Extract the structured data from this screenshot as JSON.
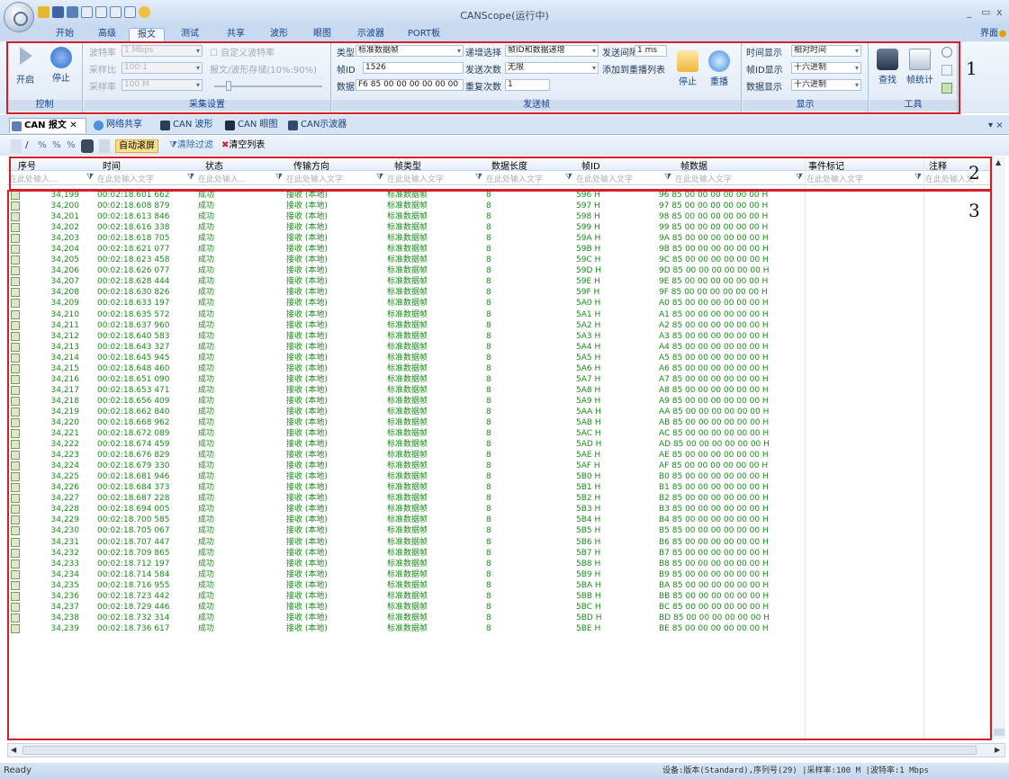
{
  "app": {
    "title": "CANScope(运行中)",
    "help": "界面"
  },
  "menu": [
    "开始",
    "高级",
    "报文",
    "测试",
    "共享",
    "波形",
    "眼图",
    "示波器",
    "PORT板"
  ],
  "ribbon": {
    "control": {
      "start": "开启",
      "stop": "停止",
      "label": "控制"
    },
    "acq": {
      "baud_label": "波特率",
      "baud_value": "1 Mbps",
      "sample_ratio_label": "采样比",
      "sample_ratio_value": "100:1",
      "sample_rate_label": "采样率",
      "sample_rate_value": "100 M",
      "custom_baud": "自定义波特率",
      "store": "报文/波形存储(10%:90%)",
      "label": "采集设置"
    },
    "send": {
      "type_label": "类型",
      "type_value": "标准数据帧",
      "id_label": "帧ID",
      "id_value": "1526",
      "data_label": "数据",
      "data_value": "F6 85 00 00 00 00 00 00",
      "inc_label": "递增选择",
      "inc_value": "帧ID和数据递增",
      "count_label": "发送次数",
      "count_value": "无限",
      "repeat_label": "重复次数",
      "repeat_value": "1",
      "interval_label": "发送间隔",
      "interval_value": "1 ms",
      "add_list": "添加到重播列表",
      "stop": "停止",
      "replay": "重播",
      "label": "发送帧"
    },
    "display": {
      "time_label": "时间显示",
      "time_value": "相对时间",
      "id_label": "帧ID显示",
      "id_value": "十六进制",
      "data_label": "数据显示",
      "data_value": "十六进制",
      "label": "显示"
    },
    "tools": {
      "find": "查找",
      "stats": "帧统计",
      "label": "工具"
    }
  },
  "doc_tabs": [
    "CAN 报文",
    "网络共享",
    "CAN 波形",
    "CAN 眼图",
    "CAN示波器"
  ],
  "toolbar2": {
    "auto_scroll": "自动滚屏",
    "clear_filter": "清除过滤",
    "clear_list": "清空列表"
  },
  "columns": [
    "序号",
    "时间",
    "状态",
    "传输方向",
    "帧类型",
    "数据长度",
    "帧ID",
    "帧数据",
    "事件标记",
    "注释"
  ],
  "filter_placeholder": "在此处输入文字",
  "filter_placeholder_short": "在此处输入...",
  "callouts": [
    "1",
    "2",
    "3"
  ],
  "rows": [
    [
      "34,199",
      "00:02:18.601 662",
      "成功",
      "接收 (本地)",
      "标准数据帧",
      "8",
      "596 H",
      "96 85 00 00 00 00 00 00 H"
    ],
    [
      "34,200",
      "00:02:18.608 879",
      "成功",
      "接收 (本地)",
      "标准数据帧",
      "8",
      "597 H",
      "97 85 00 00 00 00 00 00 H"
    ],
    [
      "34,201",
      "00:02:18.613 846",
      "成功",
      "接收 (本地)",
      "标准数据帧",
      "8",
      "598 H",
      "98 85 00 00 00 00 00 00 H"
    ],
    [
      "34,202",
      "00:02:18.616 338",
      "成功",
      "接收 (本地)",
      "标准数据帧",
      "8",
      "599 H",
      "99 85 00 00 00 00 00 00 H"
    ],
    [
      "34,203",
      "00:02:18.618 705",
      "成功",
      "接收 (本地)",
      "标准数据帧",
      "8",
      "59A H",
      "9A 85 00 00 00 00 00 00 H"
    ],
    [
      "34,204",
      "00:02:18.621 077",
      "成功",
      "接收 (本地)",
      "标准数据帧",
      "8",
      "59B H",
      "9B 85 00 00 00 00 00 00 H"
    ],
    [
      "34,205",
      "00:02:18.623 458",
      "成功",
      "接收 (本地)",
      "标准数据帧",
      "8",
      "59C H",
      "9C 85 00 00 00 00 00 00 H"
    ],
    [
      "34,206",
      "00:02:18.626 077",
      "成功",
      "接收 (本地)",
      "标准数据帧",
      "8",
      "59D H",
      "9D 85 00 00 00 00 00 00 H"
    ],
    [
      "34,207",
      "00:02:18.628 444",
      "成功",
      "接收 (本地)",
      "标准数据帧",
      "8",
      "59E H",
      "9E 85 00 00 00 00 00 00 H"
    ],
    [
      "34,208",
      "00:02:18.630 826",
      "成功",
      "接收 (本地)",
      "标准数据帧",
      "8",
      "59F H",
      "9F 85 00 00 00 00 00 00 H"
    ],
    [
      "34,209",
      "00:02:18.633 197",
      "成功",
      "接收 (本地)",
      "标准数据帧",
      "8",
      "5A0 H",
      "A0 85 00 00 00 00 00 00 H"
    ],
    [
      "34,210",
      "00:02:18.635 572",
      "成功",
      "接收 (本地)",
      "标准数据帧",
      "8",
      "5A1 H",
      "A1 85 00 00 00 00 00 00 H"
    ],
    [
      "34,211",
      "00:02:18.637 960",
      "成功",
      "接收 (本地)",
      "标准数据帧",
      "8",
      "5A2 H",
      "A2 85 00 00 00 00 00 00 H"
    ],
    [
      "34,212",
      "00:02:18.640 583",
      "成功",
      "接收 (本地)",
      "标准数据帧",
      "8",
      "5A3 H",
      "A3 85 00 00 00 00 00 00 H"
    ],
    [
      "34,213",
      "00:02:18.643 327",
      "成功",
      "接收 (本地)",
      "标准数据帧",
      "8",
      "5A4 H",
      "A4 85 00 00 00 00 00 00 H"
    ],
    [
      "34,214",
      "00:02:18.645 945",
      "成功",
      "接收 (本地)",
      "标准数据帧",
      "8",
      "5A5 H",
      "A5 85 00 00 00 00 00 00 H"
    ],
    [
      "34,215",
      "00:02:18.648 460",
      "成功",
      "接收 (本地)",
      "标准数据帧",
      "8",
      "5A6 H",
      "A6 85 00 00 00 00 00 00 H"
    ],
    [
      "34,216",
      "00:02:18.651 090",
      "成功",
      "接收 (本地)",
      "标准数据帧",
      "8",
      "5A7 H",
      "A7 85 00 00 00 00 00 00 H"
    ],
    [
      "34,217",
      "00:02:18.653 471",
      "成功",
      "接收 (本地)",
      "标准数据帧",
      "8",
      "5A8 H",
      "A8 85 00 00 00 00 00 00 H"
    ],
    [
      "34,218",
      "00:02:18.656 409",
      "成功",
      "接收 (本地)",
      "标准数据帧",
      "8",
      "5A9 H",
      "A9 85 00 00 00 00 00 00 H"
    ],
    [
      "34,219",
      "00:02:18.662 840",
      "成功",
      "接收 (本地)",
      "标准数据帧",
      "8",
      "5AA H",
      "AA 85 00 00 00 00 00 00 H"
    ],
    [
      "34,220",
      "00:02:18.668 962",
      "成功",
      "接收 (本地)",
      "标准数据帧",
      "8",
      "5AB H",
      "AB 85 00 00 00 00 00 00 H"
    ],
    [
      "34,221",
      "00:02:18.672 089",
      "成功",
      "接收 (本地)",
      "标准数据帧",
      "8",
      "5AC H",
      "AC 85 00 00 00 00 00 00 H"
    ],
    [
      "34,222",
      "00:02:18.674 459",
      "成功",
      "接收 (本地)",
      "标准数据帧",
      "8",
      "5AD H",
      "AD 85 00 00 00 00 00 00 H"
    ],
    [
      "34,223",
      "00:02:18.676 829",
      "成功",
      "接收 (本地)",
      "标准数据帧",
      "8",
      "5AE H",
      "AE 85 00 00 00 00 00 00 H"
    ],
    [
      "34,224",
      "00:02:18.679 330",
      "成功",
      "接收 (本地)",
      "标准数据帧",
      "8",
      "5AF H",
      "AF 85 00 00 00 00 00 00 H"
    ],
    [
      "34,225",
      "00:02:18.681 946",
      "成功",
      "接收 (本地)",
      "标准数据帧",
      "8",
      "5B0 H",
      "B0 85 00 00 00 00 00 00 H"
    ],
    [
      "34,226",
      "00:02:18.684 373",
      "成功",
      "接收 (本地)",
      "标准数据帧",
      "8",
      "5B1 H",
      "B1 85 00 00 00 00 00 00 H"
    ],
    [
      "34,227",
      "00:02:18.687 228",
      "成功",
      "接收 (本地)",
      "标准数据帧",
      "8",
      "5B2 H",
      "B2 85 00 00 00 00 00 00 H"
    ],
    [
      "34,228",
      "00:02:18.694 005",
      "成功",
      "接收 (本地)",
      "标准数据帧",
      "8",
      "5B3 H",
      "B3 85 00 00 00 00 00 00 H"
    ],
    [
      "34,229",
      "00:02:18.700 585",
      "成功",
      "接收 (本地)",
      "标准数据帧",
      "8",
      "5B4 H",
      "B4 85 00 00 00 00 00 00 H"
    ],
    [
      "34,230",
      "00:02:18.705 067",
      "成功",
      "接收 (本地)",
      "标准数据帧",
      "8",
      "5B5 H",
      "B5 85 00 00 00 00 00 00 H"
    ],
    [
      "34,231",
      "00:02:18.707 447",
      "成功",
      "接收 (本地)",
      "标准数据帧",
      "8",
      "5B6 H",
      "B6 85 00 00 00 00 00 00 H"
    ],
    [
      "34,232",
      "00:02:18.709 865",
      "成功",
      "接收 (本地)",
      "标准数据帧",
      "8",
      "5B7 H",
      "B7 85 00 00 00 00 00 00 H"
    ],
    [
      "34,233",
      "00:02:18.712 197",
      "成功",
      "接收 (本地)",
      "标准数据帧",
      "8",
      "5B8 H",
      "B8 85 00 00 00 00 00 00 H"
    ],
    [
      "34,234",
      "00:02:18.714 584",
      "成功",
      "接收 (本地)",
      "标准数据帧",
      "8",
      "5B9 H",
      "B9 85 00 00 00 00 00 00 H"
    ],
    [
      "34,235",
      "00:02:18.716 955",
      "成功",
      "接收 (本地)",
      "标准数据帧",
      "8",
      "5BA H",
      "BA 85 00 00 00 00 00 00 H"
    ],
    [
      "34,236",
      "00:02:18.723 442",
      "成功",
      "接收 (本地)",
      "标准数据帧",
      "8",
      "5BB H",
      "BB 85 00 00 00 00 00 00 H"
    ],
    [
      "34,237",
      "00:02:18.729 446",
      "成功",
      "接收 (本地)",
      "标准数据帧",
      "8",
      "5BC H",
      "BC 85 00 00 00 00 00 00 H"
    ],
    [
      "34,238",
      "00:02:18.732 314",
      "成功",
      "接收 (本地)",
      "标准数据帧",
      "8",
      "5BD H",
      "BD 85 00 00 00 00 00 00 H"
    ],
    [
      "34,239",
      "00:02:18.736 617",
      "成功",
      "接收 (本地)",
      "标准数据帧",
      "8",
      "5BE H",
      "BE 85 00 00 00 00 00 00 H"
    ]
  ],
  "status": {
    "left": "Ready",
    "right": "设备:版本(Standard),序列号(29) |采样率:100 M   |波特率:1 Mbps"
  },
  "colors": {
    "accent": "#15428b",
    "row_text": "#1a8c1a",
    "highlight_box": "#d41e2a"
  }
}
